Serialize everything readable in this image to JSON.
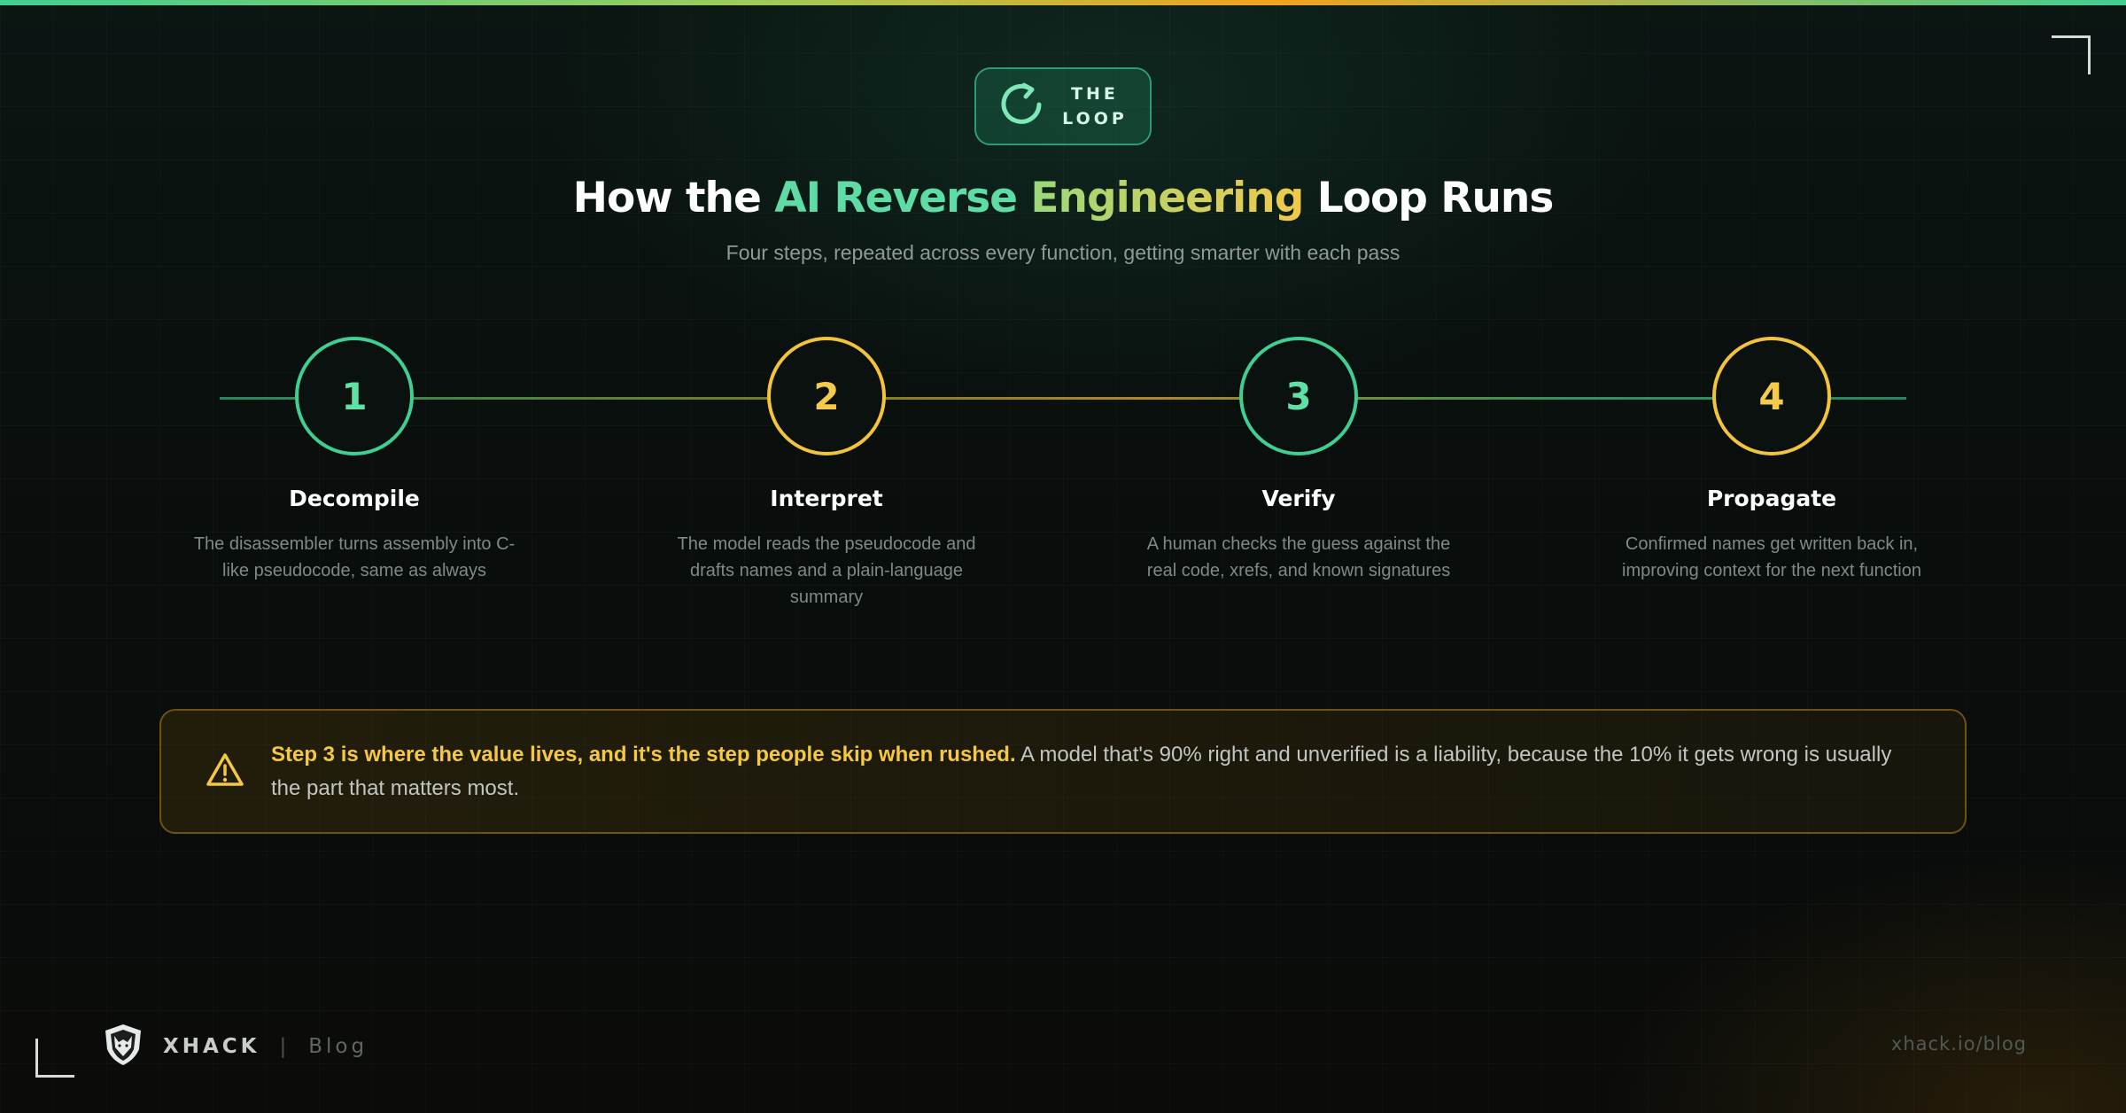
{
  "badge": {
    "line1": "THE",
    "line2": "LOOP",
    "icon": "loop-arrow-icon"
  },
  "title": {
    "part1": "How the ",
    "part2": "AI Reverse ",
    "part3": "Engineering",
    "part4": " Loop Runs"
  },
  "subtitle": "Four steps, repeated across every function, getting smarter with each pass",
  "steps": [
    {
      "number": "1",
      "title": "Decompile",
      "description": "The disassembler turns assembly into C-like pseudocode, same as always",
      "color": "#3fcf93"
    },
    {
      "number": "2",
      "title": "Interpret",
      "description": "The model reads the pseudocode and drafts names and a plain-language summary",
      "color": "#f2c33b"
    },
    {
      "number": "3",
      "title": "Verify",
      "description": "A human checks the guess against the real code, xrefs, and known signatures",
      "color": "#3fcf93"
    },
    {
      "number": "4",
      "title": "Propagate",
      "description": "Confirmed names get written back in, improving context for the next function",
      "color": "#f2c33b"
    }
  ],
  "callout": {
    "icon": "warning-icon",
    "highlight": "Step 3 is where the value lives, and it's the step people skip when rushed.",
    "body": " A model that's 90% right and unverified is a liability, because the 10% it gets wrong is usually the part that matters most."
  },
  "footer": {
    "brand": "XHACK",
    "separator": "|",
    "section": "Blog",
    "url": "xhack.io/blog",
    "logo_icon": "wolf-shield-icon"
  }
}
